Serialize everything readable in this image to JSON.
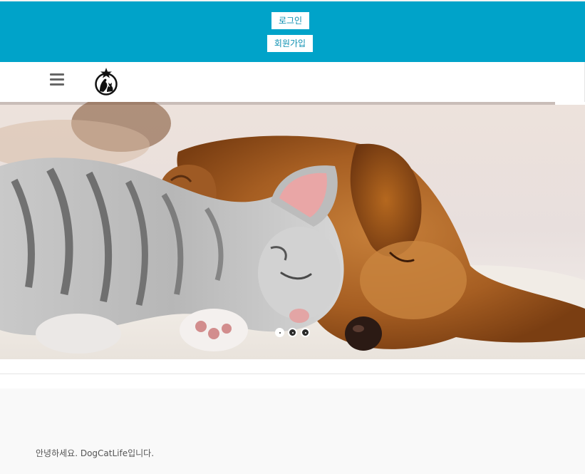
{
  "auth": {
    "login_label": "로그인",
    "signup_label": "회원가입"
  },
  "header": {
    "logo": "pet-logo-icon",
    "menu_icon": "hamburger-menu-icon"
  },
  "hero": {
    "image": "puppy-and-kitten-sleeping-photo",
    "slides": [
      "slide-1",
      "slide-2",
      "slide-3"
    ],
    "active_slide": 1
  },
  "content": {
    "greeting": "안녕하세요. DogCatLife입니다."
  },
  "colors": {
    "accent": "#00a3c9",
    "button_text": "#0b8fb1",
    "content_bg": "#f9f9f9"
  }
}
